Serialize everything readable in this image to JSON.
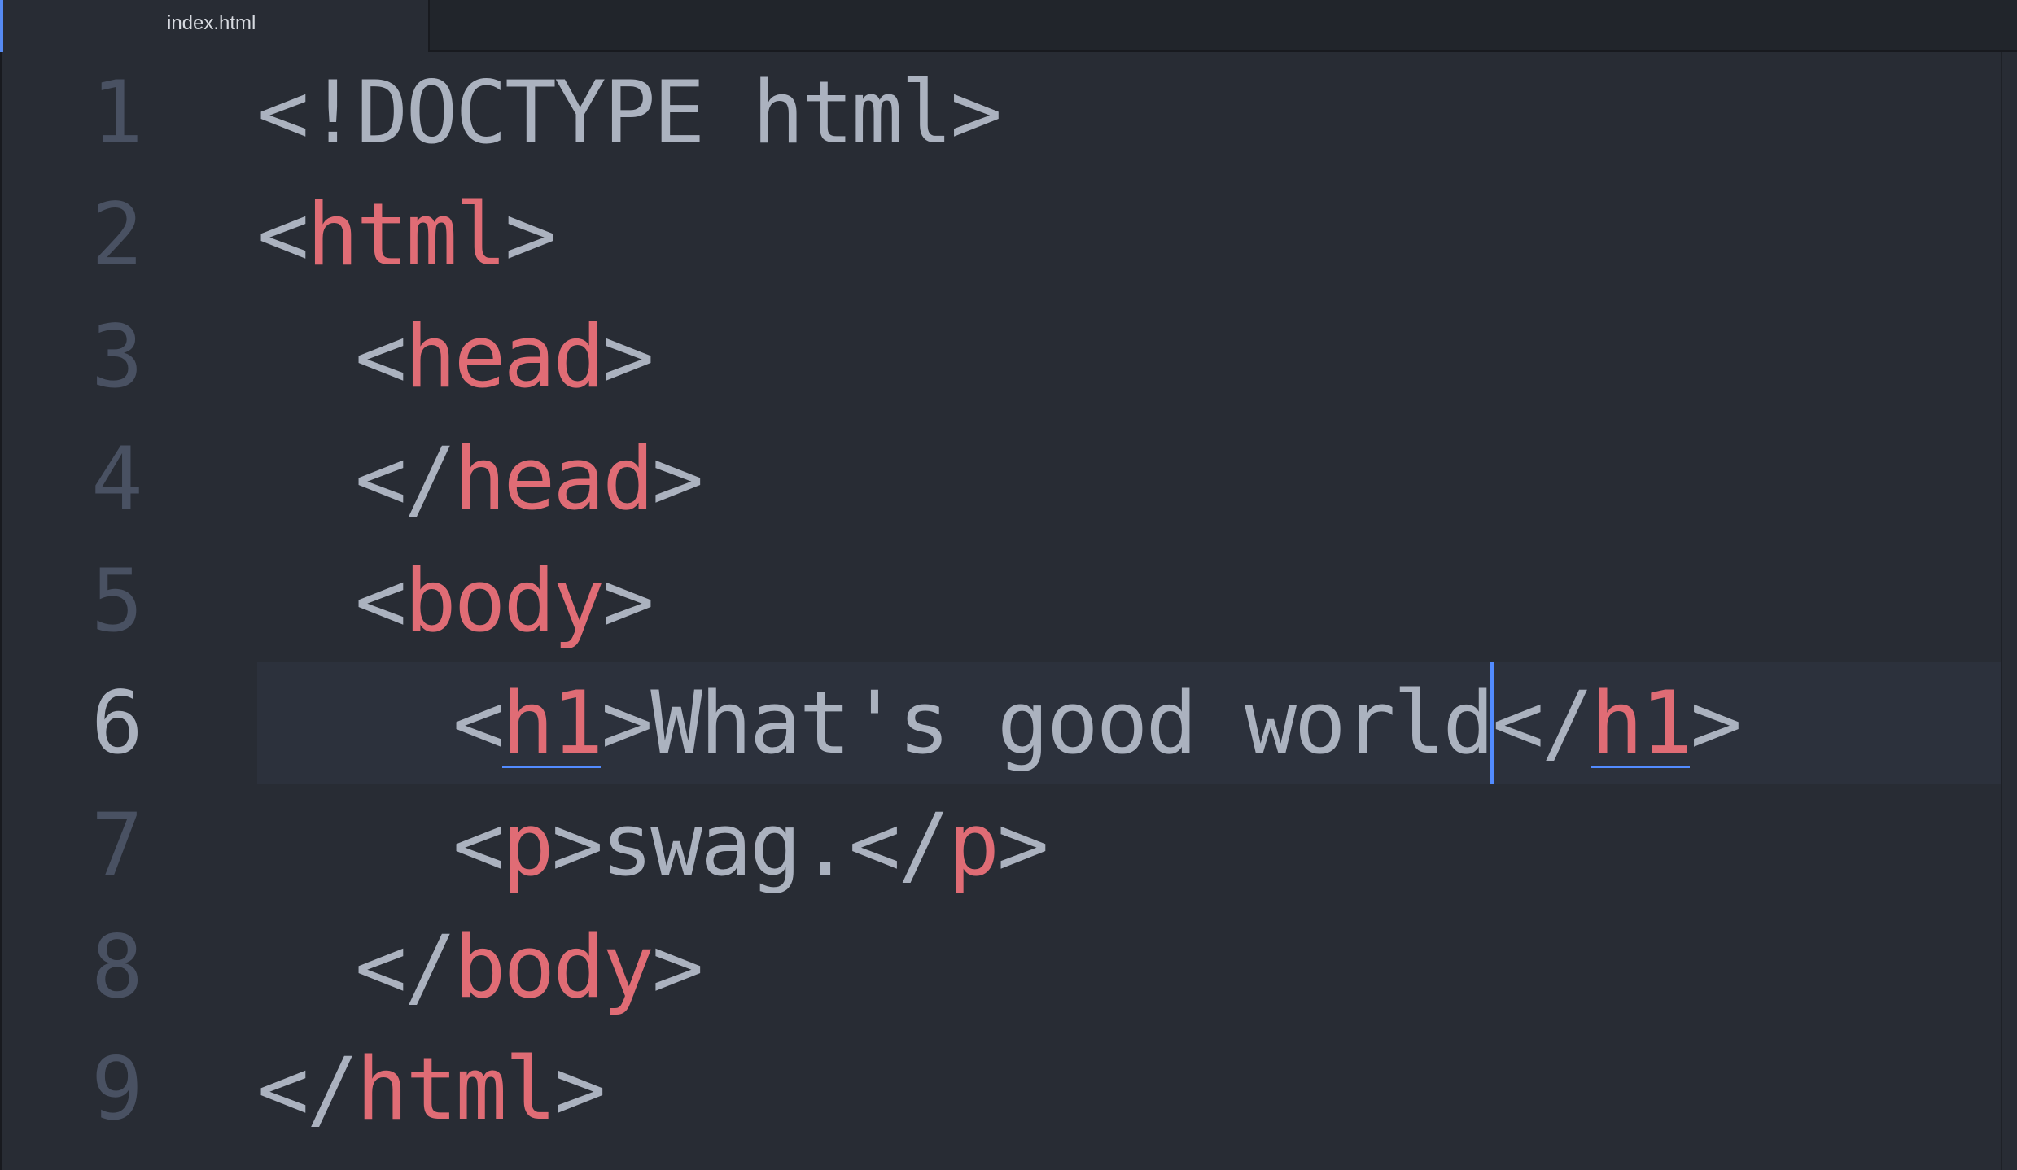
{
  "tab": {
    "title": "index.html"
  },
  "colors": {
    "background": "#282c34",
    "tab_bar": "#21252b",
    "tag": "#e06c75",
    "text": "#abb2bf",
    "gutter": "#495162",
    "cursor_line": "#2c313c",
    "caret": "#528bff"
  },
  "editor": {
    "cursor_line": 6,
    "lines": [
      {
        "number": "1",
        "parts": {
          "p1": "<!DOCTYPE html>"
        }
      },
      {
        "number": "2",
        "parts": {
          "p1": "<",
          "t1": "html",
          "p2": ">"
        }
      },
      {
        "number": "3",
        "parts": {
          "p1": "<",
          "t1": "head",
          "p2": ">"
        }
      },
      {
        "number": "4",
        "parts": {
          "p1": "</",
          "t1": "head",
          "p2": ">"
        }
      },
      {
        "number": "5",
        "parts": {
          "p1": "<",
          "t1": "body",
          "p2": ">"
        }
      },
      {
        "number": "6",
        "parts": {
          "p1": "<",
          "t1": "h1",
          "p2": ">",
          "text": "What's good world",
          "p3": "</",
          "t2": "h1",
          "p4": ">"
        }
      },
      {
        "number": "7",
        "parts": {
          "p1": "<",
          "t1": "p",
          "p2": ">",
          "text": "swag.",
          "p3": "</",
          "t2": "p",
          "p4": ">"
        }
      },
      {
        "number": "8",
        "parts": {
          "p1": "</",
          "t1": "body",
          "p2": ">"
        }
      },
      {
        "number": "9",
        "parts": {
          "p1": "</",
          "t1": "html",
          "p2": ">"
        }
      }
    ]
  }
}
